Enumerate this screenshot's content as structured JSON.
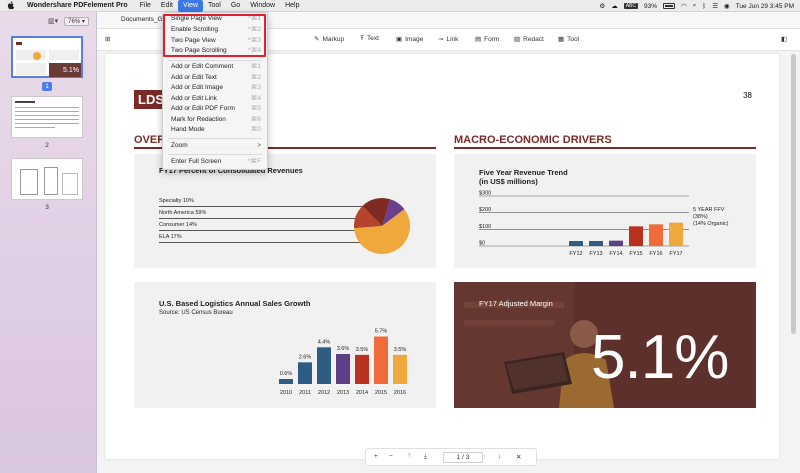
{
  "menubar": {
    "app_name": "Wondershare PDFelement Pro",
    "items": [
      "File",
      "Edit",
      "View",
      "Tool",
      "Go",
      "Window",
      "Help"
    ],
    "battery": "93%",
    "datetime": "Tue Jun 29  3:45 PM",
    "input_source": "ABC"
  },
  "sidebar": {
    "zoom": "76%",
    "thumbnails": [
      {
        "page": "1",
        "selected": true,
        "preview_text": "5.1%"
      },
      {
        "page": "2",
        "selected": false
      },
      {
        "page": "3",
        "selected": false
      }
    ]
  },
  "tab": {
    "title": "Documents_Grou"
  },
  "toolbar": {
    "markup": "Markup",
    "text": "Text",
    "image": "Image",
    "link": "Link",
    "form": "Form",
    "redact": "Redact",
    "tool": "Tool"
  },
  "view_menu": {
    "items": [
      {
        "label": "Single Page View",
        "shortcut": "^⌘1"
      },
      {
        "label": "Enable Scrolling",
        "shortcut": "^⌘2"
      },
      {
        "label": "Two Page View",
        "shortcut": "^⌘3"
      },
      {
        "label": "Two Page Scrolling",
        "shortcut": "^⌘4"
      },
      {
        "label": "Add or Edit Comment",
        "shortcut": "⌘1"
      },
      {
        "label": "Add or Edit Text",
        "shortcut": "⌘2"
      },
      {
        "label": "Add or Edit Image",
        "shortcut": "⌘3"
      },
      {
        "label": "Add or Edit Link",
        "shortcut": "⌘4"
      },
      {
        "label": "Add or Edit PDF Form",
        "shortcut": "⌘5"
      },
      {
        "label": "Mark for Redaction",
        "shortcut": "⌘6"
      },
      {
        "label": "Hand Mode",
        "shortcut": "⌘0"
      },
      {
        "label": "Zoom",
        "shortcut": ">"
      },
      {
        "label": "Enter Full Screen",
        "shortcut": "^⌘F"
      }
    ]
  },
  "document": {
    "logo": "LDS",
    "page_number": "38",
    "left_section": "OVERVIEW",
    "right_section": "MACRO-ECONOMIC DRIVERS",
    "panel1": {
      "title": "FY17 Percent of Consolidated Revenues",
      "rows": [
        "Specialty 10%",
        "North America 59%",
        "Consumer 14%",
        "ELA 17%"
      ]
    },
    "panel2": {
      "title_line1": "Five Year Revenue Trend",
      "title_line2": "(in US$ millions)",
      "yticks": [
        "$300",
        "$200",
        "$100",
        "$0"
      ],
      "annotation": [
        "5 YEAR FFV",
        "(38%)",
        "(14% Organic)"
      ]
    },
    "panel3": {
      "title": "U.S. Based Logistics Annual Sales Growth",
      "source": "Source: US Census Bureau"
    },
    "panel4": {
      "title": "FY17 Adjusted Margin",
      "big_value": "5.1%"
    }
  },
  "bottom_nav": {
    "current_page": "1",
    "total_pages": "3"
  },
  "chart_data": [
    {
      "type": "pie",
      "title": "FY17 Percent of Consolidated Revenues",
      "categories": [
        "Specialty",
        "North America",
        "Consumer",
        "ELA"
      ],
      "values": [
        10,
        59,
        14,
        17
      ],
      "colors": [
        "#6b3f8e",
        "#eea83c",
        "#b2452c",
        "#7f2a22"
      ]
    },
    {
      "type": "bar",
      "title": "Five Year Revenue Trend (in US$ millions)",
      "categories": [
        "FY12",
        "FY13",
        "FY14",
        "FY15",
        "FY16",
        "FY17"
      ],
      "values": [
        30,
        30,
        32,
        118,
        130,
        140
      ],
      "colors": [
        "#2e5c84",
        "#2e5c84",
        "#5c3f86",
        "#b7331f",
        "#ef6c3a",
        "#eea83c"
      ],
      "ylim": [
        0,
        300
      ],
      "ticks": [
        "$0",
        "$100",
        "$200",
        "$300"
      ]
    },
    {
      "type": "bar",
      "title": "U.S. Based Logistics Annual Sales Growth",
      "categories": [
        "2010",
        "2011",
        "2012",
        "2013",
        "2014",
        "2015",
        "2016"
      ],
      "values": [
        0.6,
        2.6,
        4.4,
        3.6,
        3.5,
        5.7,
        3.5
      ],
      "labels": [
        "0.6%",
        "2.6%",
        "4.4%",
        "3.6%",
        "3.5%",
        "5.7%",
        "3.5%"
      ],
      "colors": [
        "#2e5c84",
        "#2e5c84",
        "#2e5c84",
        "#5c3f86",
        "#b7331f",
        "#ef6c3a",
        "#eea83c"
      ],
      "ylim": [
        0,
        6
      ]
    }
  ]
}
